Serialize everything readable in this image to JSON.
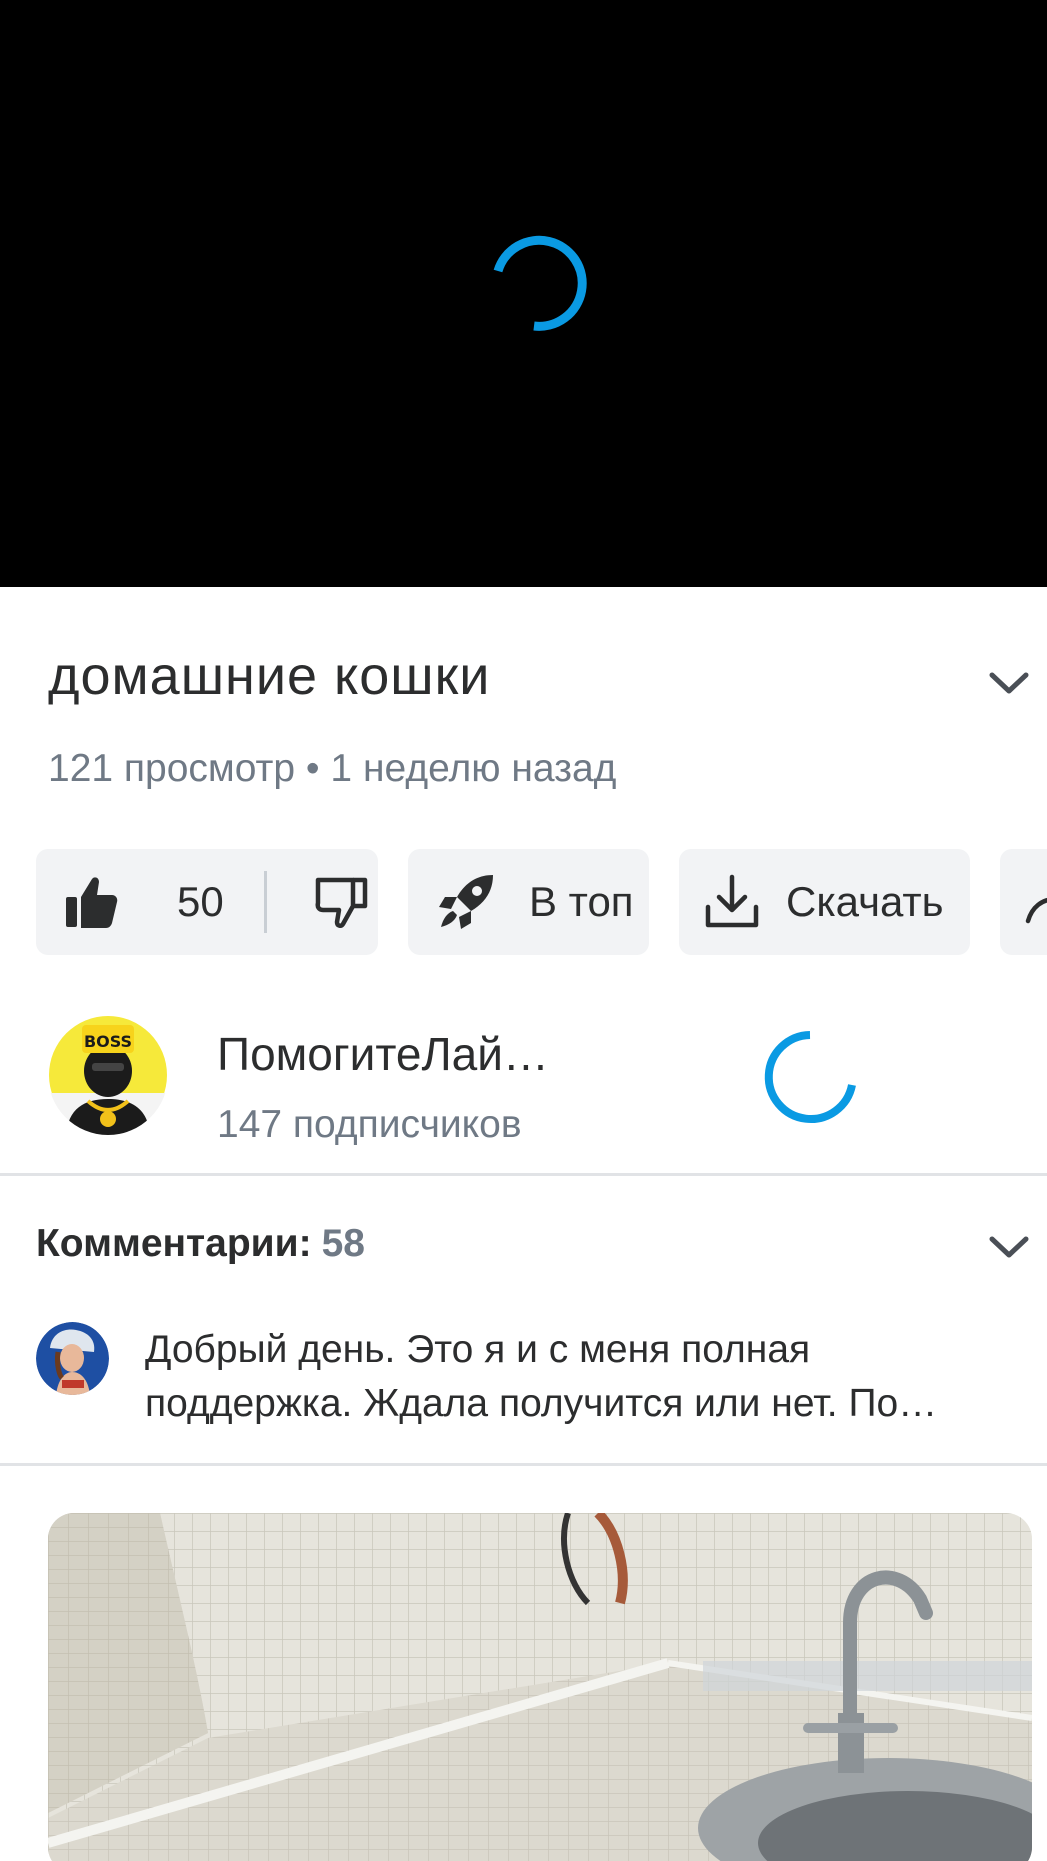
{
  "video": {
    "title": "домашние кошки",
    "meta": "121 просмотр • 1 неделю назад"
  },
  "actions": {
    "likes": "50",
    "boost_label": "В топ",
    "download_label": "Скачать"
  },
  "channel": {
    "name": "ПомогитеЛай…",
    "subscribers": "147 подписчиков"
  },
  "comments": {
    "heading": "Комментарии:",
    "count": "58",
    "preview": {
      "line1": "Добрый день. Это я и с меня полная",
      "line2": "поддержка. Ждала получится или нет. По…"
    }
  },
  "icons": {
    "player_spinner": "loading-spinner-icon",
    "collapse": "chevron-down-icon",
    "like": "thumbs-up-icon",
    "dislike": "thumbs-down-icon",
    "boost": "rocket-icon",
    "download": "download-icon",
    "share": "share-icon"
  },
  "colors": {
    "accent": "#0a9ae3",
    "text_primary": "#2c2d2e",
    "text_secondary": "#6f7985",
    "pill_bg": "#f2f3f5",
    "divider": "#e1e3e6"
  }
}
